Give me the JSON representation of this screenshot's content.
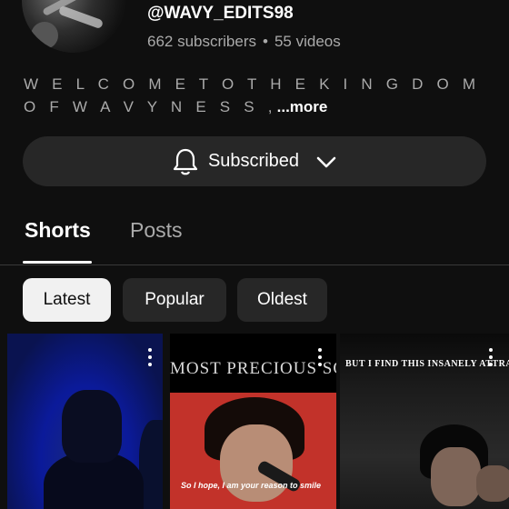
{
  "channel": {
    "handle": "@WAVY_EDITS98",
    "subscribers": "662 subscribers",
    "separator": "•",
    "videos": "55 videos",
    "description": "W E L C O M E  T O  T H E  K I N G D O M  O F  W A V Y N E S S ,",
    "more_label": "...more"
  },
  "subscribe_button": {
    "label": "Subscribed",
    "icon": "bell-icon",
    "dropdown_icon": "chevron-down-icon"
  },
  "tabs": [
    {
      "label": "Shorts",
      "active": true
    },
    {
      "label": "Posts",
      "active": false
    }
  ],
  "filters": [
    {
      "label": "Latest",
      "selected": true
    },
    {
      "label": "Popular",
      "selected": false
    },
    {
      "label": "Oldest",
      "selected": false
    }
  ],
  "shorts": [
    {
      "overlay_text": ""
    },
    {
      "overlay_text": "MOST PRECIOUS SO",
      "caption": "So I hope, I am your reason to smile"
    },
    {
      "overlay_text": "BUT I FIND THIS INSANELY ATTRAC"
    }
  ],
  "colors": {
    "background": "#0f0f0f",
    "button_bg": "#272727",
    "selected_chip_bg": "#f1f1f1",
    "secondary_text": "#aaaaaa"
  }
}
